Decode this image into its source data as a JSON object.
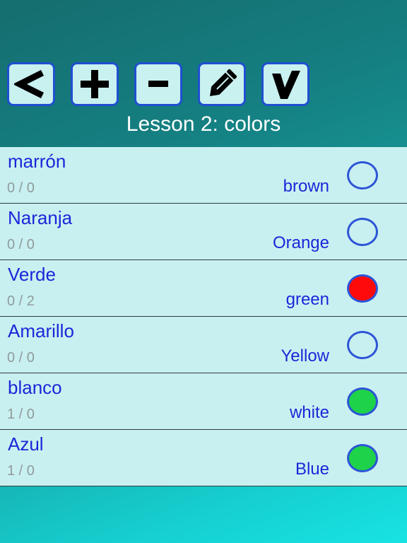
{
  "toolbar": {
    "buttons": [
      {
        "icon": "back-icon"
      },
      {
        "icon": "plus-icon"
      },
      {
        "icon": "minus-icon"
      },
      {
        "icon": "pencil-icon"
      },
      {
        "icon": "checkmark-icon"
      }
    ]
  },
  "lesson": {
    "title": "Lesson 2: colors"
  },
  "colors": {
    "button_border": "#1f4fd1",
    "button_fill": "#c9f1ef",
    "word_text": "#1a27d9",
    "score_text": "#8f9b9b",
    "row_bg": "#c9f0f0",
    "status_none": "transparent",
    "status_bad": "#ff0a0a",
    "status_good": "#1ed24a"
  },
  "words": [
    {
      "word": "marrón",
      "score": "0 / 0",
      "translation": "brown",
      "status": "none"
    },
    {
      "word": "Naranja",
      "score": "0 / 0",
      "translation": "Orange",
      "status": "none"
    },
    {
      "word": "Verde",
      "score": "0 / 2",
      "translation": "green",
      "status": "bad"
    },
    {
      "word": "Amarillo",
      "score": "0 / 0",
      "translation": "Yellow",
      "status": "none"
    },
    {
      "word": "blanco",
      "score": "1 / 0",
      "translation": "white",
      "status": "good"
    },
    {
      "word": "Azul",
      "score": "1 / 0",
      "translation": "Blue",
      "status": "good"
    }
  ]
}
